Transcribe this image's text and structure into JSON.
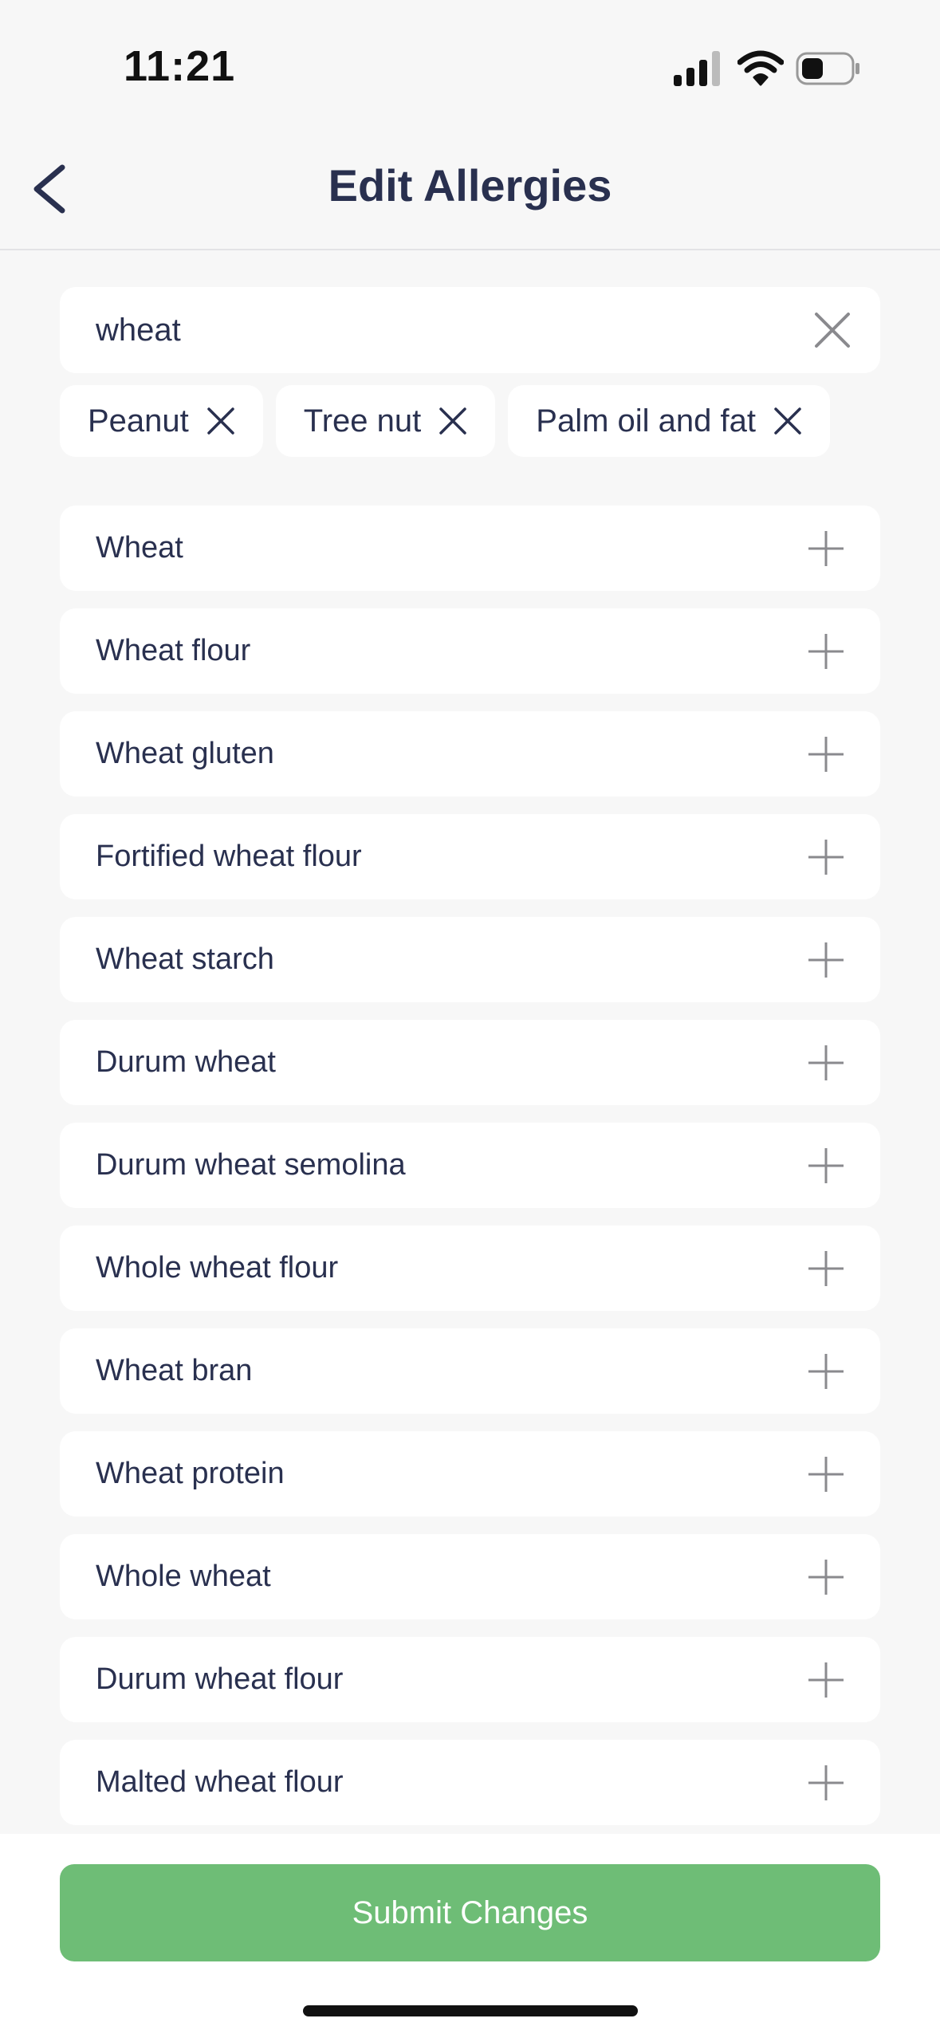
{
  "status_bar": {
    "time": "11:21",
    "icons": [
      "signal-icon",
      "wifi-icon",
      "battery-icon"
    ]
  },
  "nav": {
    "title": "Edit Allergies",
    "back_icon": "chevron-left-icon"
  },
  "search": {
    "value": "wheat",
    "clear_icon": "close-icon"
  },
  "selected_allergies": [
    {
      "label": "Peanut"
    },
    {
      "label": "Tree nut"
    },
    {
      "label": "Palm oil and fat"
    }
  ],
  "results": [
    {
      "label": "Wheat"
    },
    {
      "label": "Wheat flour"
    },
    {
      "label": "Wheat gluten"
    },
    {
      "label": "Fortified wheat flour"
    },
    {
      "label": "Wheat starch"
    },
    {
      "label": "Durum wheat"
    },
    {
      "label": "Durum wheat semolina"
    },
    {
      "label": "Whole wheat flour"
    },
    {
      "label": "Wheat bran"
    },
    {
      "label": "Wheat protein"
    },
    {
      "label": "Whole wheat"
    },
    {
      "label": "Durum wheat flour"
    },
    {
      "label": "Malted wheat flour"
    }
  ],
  "submit": {
    "label": "Submit Changes"
  },
  "colors": {
    "background": "#f7f7f7",
    "text": "#29304f",
    "submit": "#6ebd76"
  }
}
